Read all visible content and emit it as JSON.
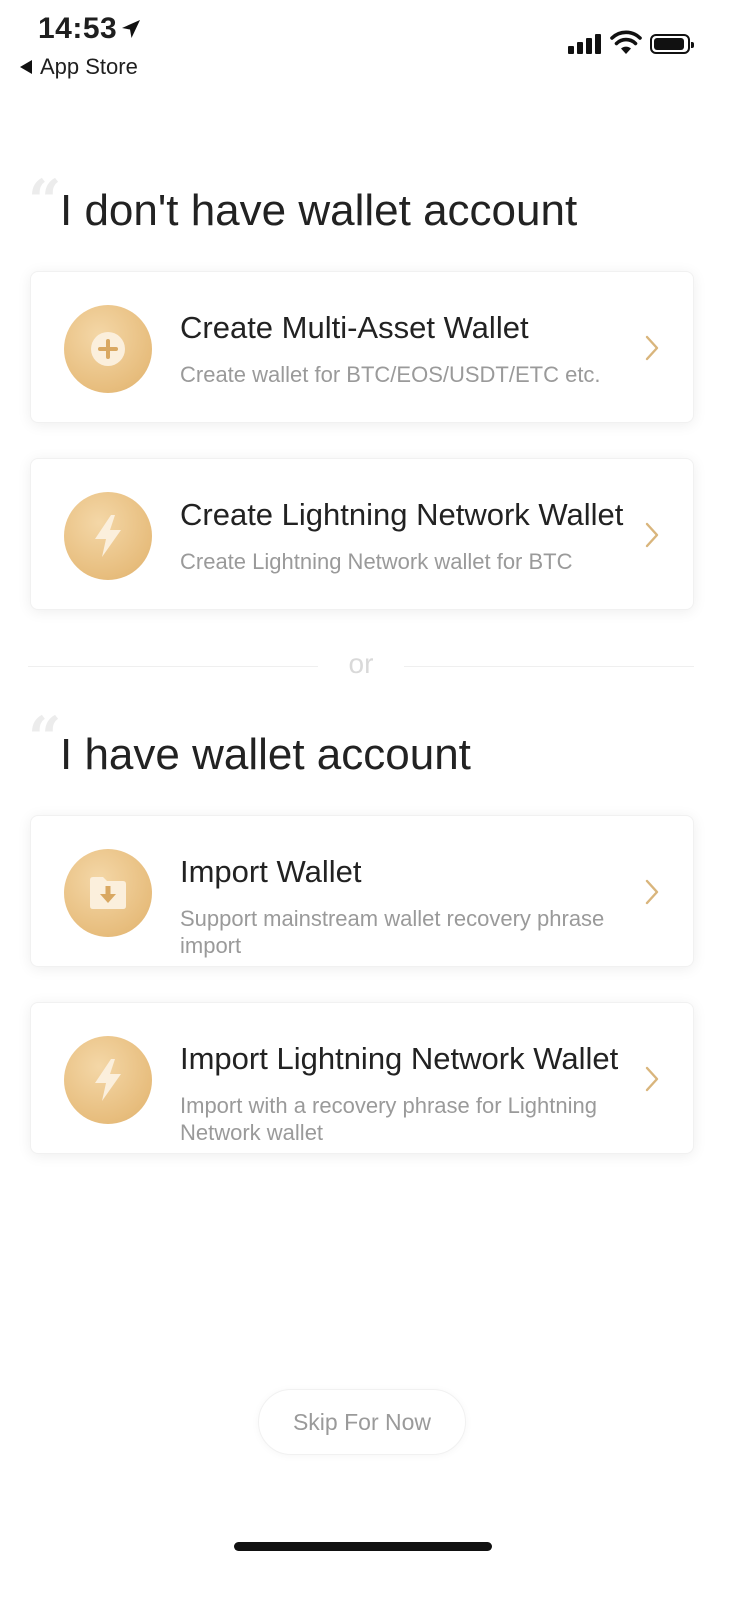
{
  "status_bar": {
    "time": "14:53",
    "back_app": "App Store",
    "icons": [
      "location-arrow-icon",
      "cellular-signal-icon",
      "wifi-icon",
      "battery-icon"
    ]
  },
  "section_no_account": {
    "title": "I don't have wallet account",
    "cards": [
      {
        "title": "Create Multi-Asset Wallet",
        "description": "Create wallet for BTC/EOS/USDT/ETC etc.",
        "icon": "plus-icon"
      },
      {
        "title": "Create Lightning Network Wallet",
        "description": "Create Lightning Network wallet for BTC",
        "icon": "lightning-icon"
      }
    ]
  },
  "divider_text": "or",
  "section_have_account": {
    "title": "I have wallet account",
    "cards": [
      {
        "title": "Import Wallet",
        "description": "Support mainstream wallet recovery phrase import",
        "icon": "folder-download-icon"
      },
      {
        "title": "Import Lightning Network Wallet",
        "description": "Import with a recovery phrase for Lightning Network wallet",
        "icon": "lightning-icon"
      }
    ]
  },
  "skip_label": "Skip For Now",
  "colors": {
    "accent_gold": "#e7bd7d",
    "chevron": "#d9b57c",
    "muted_text": "#9a9a9a"
  }
}
